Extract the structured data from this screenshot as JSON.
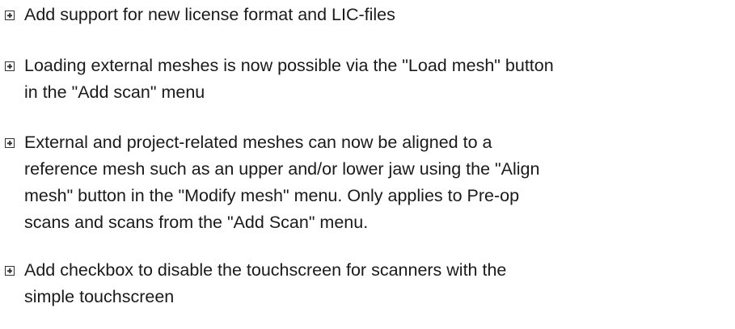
{
  "items": [
    {
      "lines": [
        "Add support for new license format and LIC-files"
      ]
    },
    {
      "lines": [
        "Loading external meshes is now possible via the \"Load mesh\" button",
        "in the \"Add scan\" menu"
      ]
    },
    {
      "lines": [
        "External and project-related meshes can now be aligned to a",
        "reference mesh such as an upper and/or lower jaw using the \"Align",
        "mesh\" button in the \"Modify mesh\" menu. Only applies to Pre-op",
        "scans and scans from the \"Add Scan\" menu."
      ]
    },
    {
      "lines": [
        "Add checkbox to disable the touchscreen for scanners with the",
        "simple touchscreen"
      ]
    }
  ]
}
